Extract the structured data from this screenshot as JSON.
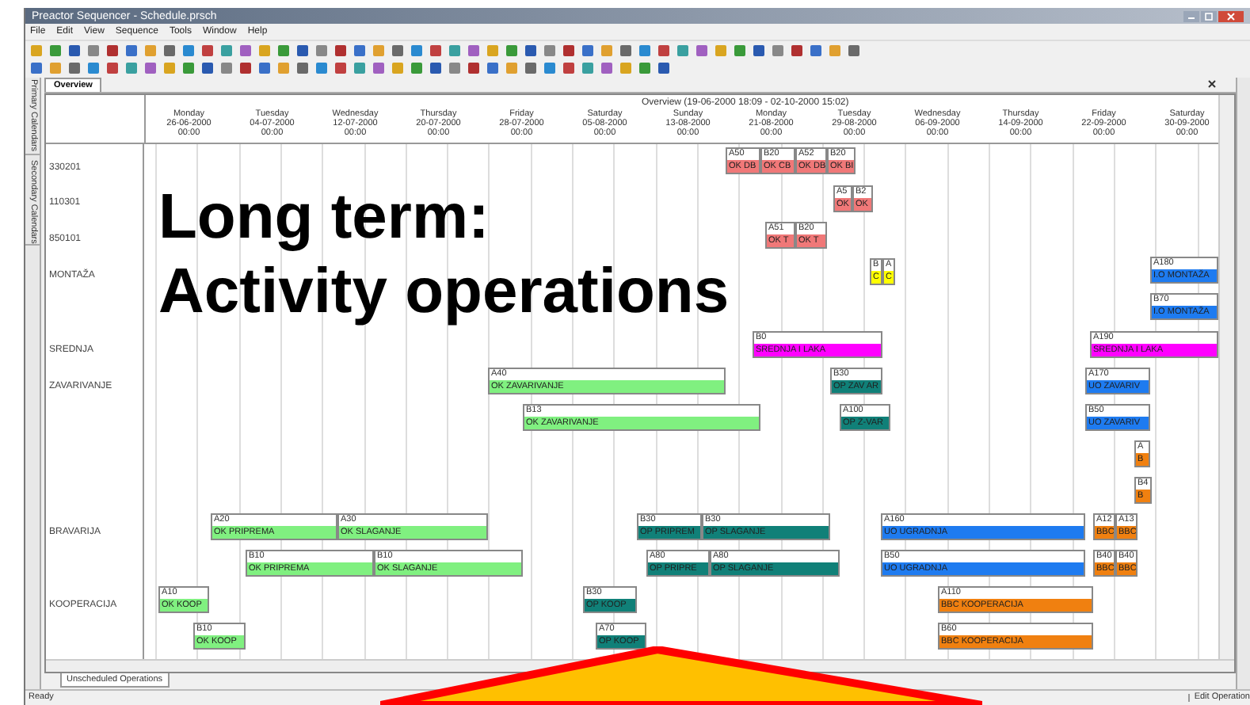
{
  "window": {
    "title": "Preactor Sequencer - Schedule.prsch"
  },
  "menu": [
    "File",
    "Edit",
    "View",
    "Sequence",
    "Tools",
    "Window",
    "Help"
  ],
  "side_tabs": [
    "Primary Calendars",
    "Secondary Calendars"
  ],
  "tabs": [
    {
      "label": "Overview",
      "selected": true
    }
  ],
  "overview_range": "Overview  (19-06-2000 18:09 - 02-10-2000 15:02)",
  "days": [
    {
      "day": "Monday",
      "date": "26-06-2000",
      "time": "00:00"
    },
    {
      "day": "Tuesday",
      "date": "04-07-2000",
      "time": "00:00"
    },
    {
      "day": "Wednesday",
      "date": "12-07-2000",
      "time": "00:00"
    },
    {
      "day": "Thursday",
      "date": "20-07-2000",
      "time": "00:00"
    },
    {
      "day": "Friday",
      "date": "28-07-2000",
      "time": "00:00"
    },
    {
      "day": "Saturday",
      "date": "05-08-2000",
      "time": "00:00"
    },
    {
      "day": "Sunday",
      "date": "13-08-2000",
      "time": "00:00"
    },
    {
      "day": "Monday",
      "date": "21-08-2000",
      "time": "00:00"
    },
    {
      "day": "Tuesday",
      "date": "29-08-2000",
      "time": "00:00"
    },
    {
      "day": "Wednesday",
      "date": "06-09-2000",
      "time": "00:00"
    },
    {
      "day": "Thursday",
      "date": "14-09-2000",
      "time": "00:00"
    },
    {
      "day": "Friday",
      "date": "22-09-2000",
      "time": "00:00"
    },
    {
      "day": "Saturday",
      "date": "30-09-2000",
      "time": "00:00"
    }
  ],
  "resources": [
    "330201",
    "110301",
    "850101",
    "MONTAŽA",
    "SREDNJA",
    "ZAVARIVANJE",
    "BRAVARIJA",
    "KOOPERACIJA"
  ],
  "operations": [
    {
      "id": "A50",
      "name": "OK DB",
      "color": "#f07878"
    },
    {
      "id": "B20",
      "name": "OK CB",
      "color": "#f07878"
    },
    {
      "id": "A52",
      "name": "OK DB",
      "color": "#f07878"
    },
    {
      "id": "B20",
      "name": "OK BI",
      "color": "#f07878"
    },
    {
      "id": "A5",
      "name": "OK",
      "color": "#f07878"
    },
    {
      "id": "B2",
      "name": "OK",
      "color": "#f07878"
    },
    {
      "id": "A51",
      "name": "OK T",
      "color": "#f07878"
    },
    {
      "id": "B20",
      "name": "OK T",
      "color": "#f07878"
    },
    {
      "id": "B",
      "name": "C",
      "color": "#ffff00"
    },
    {
      "id": "A",
      "name": "C",
      "color": "#ffff00"
    },
    {
      "id": "B0",
      "name": "SREDNJA I LAKA",
      "color": "#ff00ff"
    },
    {
      "id": "A190",
      "name": "SREDNJA I LAKA",
      "color": "#ff00ff"
    },
    {
      "id": "A180",
      "name": "I.O MONTAŽA",
      "color": "#1e7bf0"
    },
    {
      "id": "B70",
      "name": "I.O MONTAŽA",
      "color": "#1e7bf0"
    },
    {
      "id": "A40",
      "name": "OK ZAVARIVANJE",
      "color": "#80f080"
    },
    {
      "id": "B13",
      "name": "OK ZAVARIVANJE",
      "color": "#80f080"
    },
    {
      "id": "A20",
      "name": "OK PRIPREMA",
      "color": "#80f080"
    },
    {
      "id": "A30",
      "name": "OK SLAGANJE",
      "color": "#80f080"
    },
    {
      "id": "B10",
      "name": "OK PRIPREMA",
      "color": "#80f080"
    },
    {
      "id": "B10",
      "name": "OK SLAGANJE",
      "color": "#80f080"
    },
    {
      "id": "A10",
      "name": "OK KOOP",
      "color": "#80f080"
    },
    {
      "id": "B10",
      "name": "OK KOOP",
      "color": "#80f080"
    },
    {
      "id": "B30",
      "name": "OP ZAV AR",
      "color": "#108078"
    },
    {
      "id": "A100",
      "name": "OP Z-VAR",
      "color": "#108078"
    },
    {
      "id": "B30",
      "name": "OP PRIPREM",
      "color": "#108078"
    },
    {
      "id": "B30",
      "name": "OP SLAGANJE",
      "color": "#108078"
    },
    {
      "id": "A80",
      "name": "OP PRIPRE",
      "color": "#108078"
    },
    {
      "id": "A80",
      "name": "OP SLAGANJE",
      "color": "#108078"
    },
    {
      "id": "B30",
      "name": "OP KOOP",
      "color": "#108078"
    },
    {
      "id": "A70",
      "name": "OP KOOP",
      "color": "#108078"
    },
    {
      "id": "A170",
      "name": "UO ZAVARIV",
      "color": "#1e7bf0"
    },
    {
      "id": "B50",
      "name": "UO ZAVARIV",
      "color": "#1e7bf0"
    },
    {
      "id": "A160",
      "name": "UO UGRADNJA",
      "color": "#1e7bf0"
    },
    {
      "id": "B50",
      "name": "UO UGRADNJA",
      "color": "#1e7bf0"
    },
    {
      "id": "A110",
      "name": "BBC KOOPERACIJA",
      "color": "#f08010"
    },
    {
      "id": "B60",
      "name": "BBC KOOPERACIJA",
      "color": "#f08010"
    },
    {
      "id": "A12",
      "name": "BBC",
      "color": "#f08010"
    },
    {
      "id": "A13",
      "name": "BBC",
      "color": "#f08010"
    },
    {
      "id": "B40",
      "name": "BBC",
      "color": "#f08010"
    },
    {
      "id": "B40",
      "name": "BBC",
      "color": "#f08010"
    },
    {
      "id": "A",
      "name": "B",
      "color": "#f08010"
    },
    {
      "id": "B4",
      "name": "B",
      "color": "#f08010"
    }
  ],
  "overlay": {
    "lines": [
      "Long term:",
      "Activity operations"
    ]
  },
  "bottom_tabs": [
    {
      "label": "Unscheduled Operations"
    }
  ],
  "status_bar": {
    "left": "Ready",
    "right": "Edit Operation"
  }
}
